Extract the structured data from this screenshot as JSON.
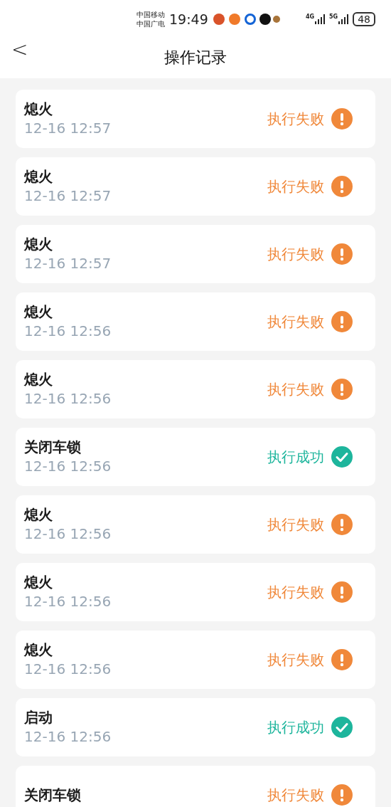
{
  "status_bar": {
    "carriers": [
      "中国移动",
      "中国广电"
    ],
    "time": "19:49",
    "network_labels": [
      "4G",
      "5G"
    ],
    "battery": "48"
  },
  "header": {
    "back": "<",
    "title": "操作记录"
  },
  "records": [
    {
      "action": "熄火",
      "time": "12-16 12:57",
      "status": "执行失败",
      "kind": "failed"
    },
    {
      "action": "熄火",
      "time": "12-16 12:57",
      "status": "执行失败",
      "kind": "failed"
    },
    {
      "action": "熄火",
      "time": "12-16 12:57",
      "status": "执行失败",
      "kind": "failed"
    },
    {
      "action": "熄火",
      "time": "12-16 12:56",
      "status": "执行失败",
      "kind": "failed"
    },
    {
      "action": "熄火",
      "time": "12-16 12:56",
      "status": "执行失败",
      "kind": "failed"
    },
    {
      "action": "关闭车锁",
      "time": "12-16 12:56",
      "status": "执行成功",
      "kind": "success"
    },
    {
      "action": "熄火",
      "time": "12-16 12:56",
      "status": "执行失败",
      "kind": "failed"
    },
    {
      "action": "熄火",
      "time": "12-16 12:56",
      "status": "执行失败",
      "kind": "failed"
    },
    {
      "action": "熄火",
      "time": "12-16 12:56",
      "status": "执行失败",
      "kind": "failed"
    },
    {
      "action": "启动",
      "time": "12-16 12:56",
      "status": "执行成功",
      "kind": "success"
    },
    {
      "action": "关闭车锁",
      "status": "执行失败",
      "kind": "failed"
    }
  ]
}
